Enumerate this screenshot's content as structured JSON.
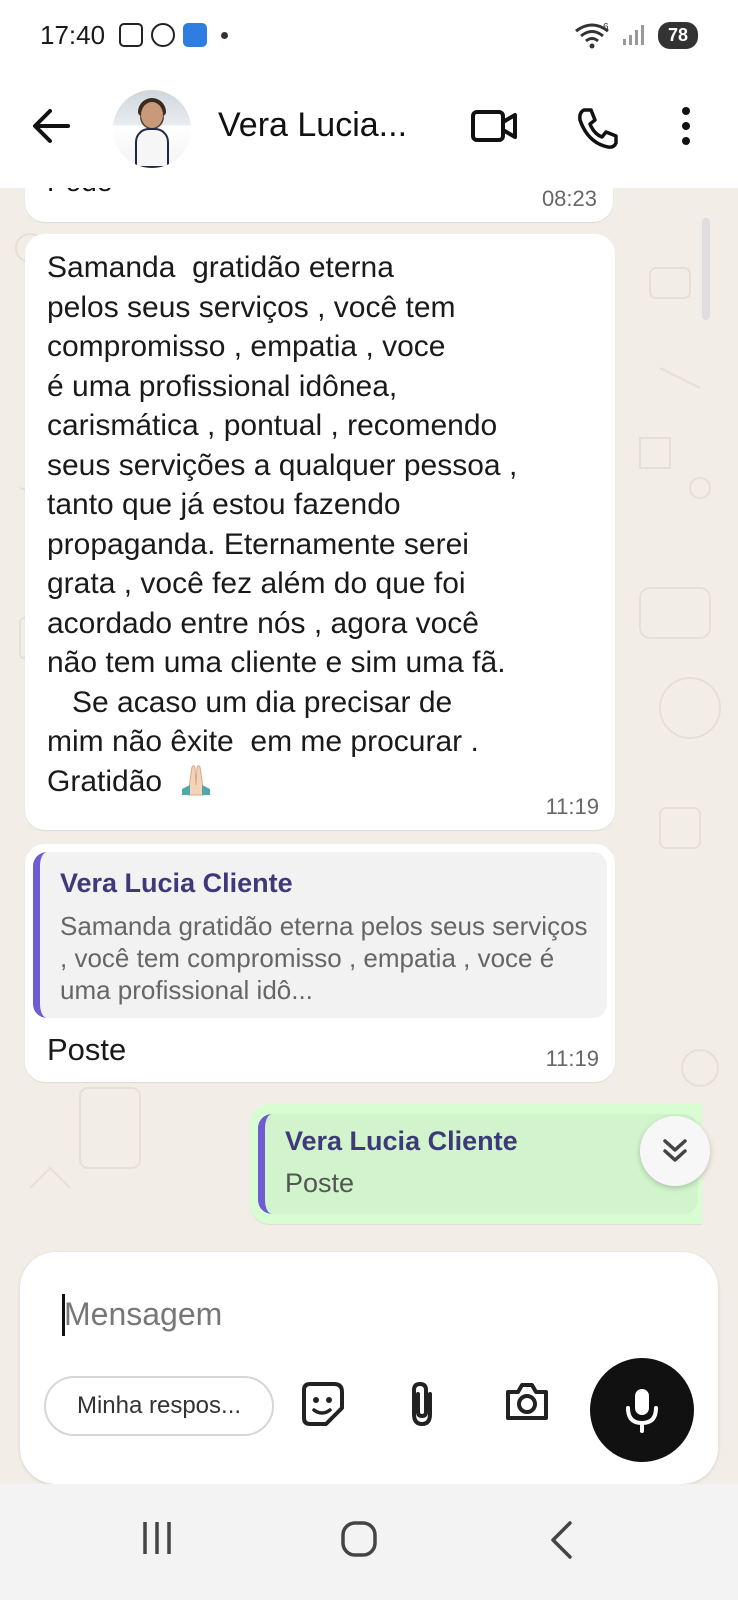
{
  "status_bar": {
    "time": "17:40",
    "battery": "78",
    "network_label": "6"
  },
  "header": {
    "contact_name": "Vera Lucia..."
  },
  "messages": {
    "partial_top": {
      "text": "Pode",
      "time": "08:23"
    },
    "long": {
      "lines": [
        "Samanda  gratidão eterna",
        "pelos seus serviços , você tem",
        "compromisso , empatia , voce",
        "é uma profissional idônea,",
        "carismática , pontual , recomendo",
        "seus servições a qualquer pessoa ,",
        "tanto que já estou fazendo",
        "propaganda. Eternamente serei",
        "grata , você fez além do que foi",
        "acordado entre nós , agora você",
        "não tem uma cliente e sim uma fã.",
        "   Se acaso um dia precisar de",
        "mim não êxite  em me procurar .",
        "Gratidão"
      ],
      "emoji": "praying-hands",
      "time": "11:19"
    },
    "reply_incoming": {
      "quote_author": "Vera Lucia Cliente",
      "quote_text": "Samanda  gratidão eterna pelos seus serviços , você tem compromisso , empatia , voce é uma profissional idô...",
      "text": "Poste",
      "time": "11:19"
    },
    "reply_outgoing": {
      "quote_author": "Vera Lucia Cliente",
      "quote_text": "Poste"
    }
  },
  "compose": {
    "placeholder": "Mensagem",
    "quick_reply": "Minha respos..."
  },
  "colors": {
    "chat_bg": "#f2ede6",
    "outgoing_bubble": "#d9fdd3",
    "quote_bar": "#6f5bd3",
    "quote_author": "#3e3a7a"
  }
}
